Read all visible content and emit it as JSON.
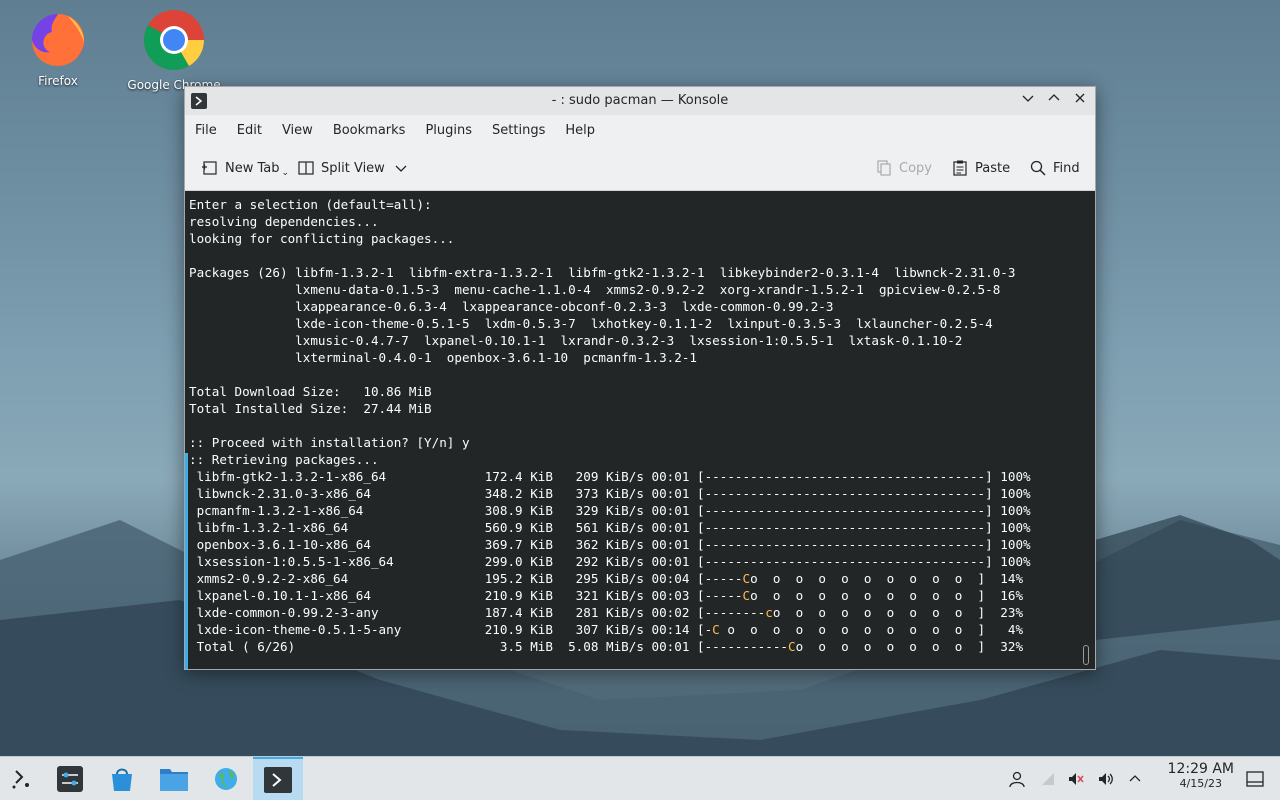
{
  "desktop": {
    "icons": [
      {
        "label": "Firefox",
        "icon": "firefox-icon"
      },
      {
        "label": "Google Chrome",
        "icon": "chrome-icon"
      }
    ]
  },
  "window": {
    "title": "- : sudo pacman — Konsole",
    "menu": [
      "File",
      "Edit",
      "View",
      "Bookmarks",
      "Plugins",
      "Settings",
      "Help"
    ],
    "toolbar": {
      "new_tab": "New Tab",
      "split_view": "Split View",
      "copy": "Copy",
      "paste": "Paste",
      "find": "Find"
    }
  },
  "terminal": {
    "lines": [
      "Enter a selection (default=all):",
      "resolving dependencies...",
      "looking for conflicting packages...",
      "",
      "Packages (26) libfm-1.3.2-1  libfm-extra-1.3.2-1  libfm-gtk2-1.3.2-1  libkeybinder2-0.3.1-4  libwnck-2.31.0-3",
      "              lxmenu-data-0.1.5-3  menu-cache-1.1.0-4  xmms2-0.9.2-2  xorg-xrandr-1.5.2-1  gpicview-0.2.5-8",
      "              lxappearance-0.6.3-4  lxappearance-obconf-0.2.3-3  lxde-common-0.99.2-3",
      "              lxde-icon-theme-0.5.1-5  lxdm-0.5.3-7  lxhotkey-0.1.1-2  lxinput-0.3.5-3  lxlauncher-0.2.5-4",
      "              lxmusic-0.4.7-7  lxpanel-0.10.1-1  lxrandr-0.3.2-3  lxsession-1:0.5.5-1  lxtask-0.1.10-2",
      "              lxterminal-0.4.0-1  openbox-3.6.1-10  pcmanfm-1.3.2-1",
      "",
      "Total Download Size:   10.86 MiB",
      "Total Installed Size:  27.44 MiB",
      "",
      ":: Proceed with installation? [Y/n] y",
      ":: Retrieving packages...",
      " libfm-gtk2-1.3.2-1-x86_64             172.4 KiB   209 KiB/s 00:01 [-------------------------------------] 100%",
      " libwnck-2.31.0-3-x86_64               348.2 KiB   373 KiB/s 00:01 [-------------------------------------] 100%",
      " pcmanfm-1.3.2-1-x86_64                308.9 KiB   329 KiB/s 00:01 [-------------------------------------] 100%",
      " libfm-1.3.2-1-x86_64                  560.9 KiB   561 KiB/s 00:01 [-------------------------------------] 100%",
      " openbox-3.6.1-10-x86_64               369.7 KiB   362 KiB/s 00:01 [-------------------------------------] 100%",
      " lxsession-1:0.5.5-1-x86_64            299.0 KiB   292 KiB/s 00:01 [-------------------------------------] 100%"
    ],
    "progress_lines": [
      {
        "pre": " xmms2-0.9.2-2-x86_64                  195.2 KiB   295 KiB/s 00:04 [-----",
        "mark": "C",
        "post": "o  o  o  o  o  o  o  o  o  o  ]  14%"
      },
      {
        "pre": " lxpanel-0.10.1-1-x86_64               210.9 KiB   321 KiB/s 00:03 [-----",
        "mark": "C",
        "post": "o  o  o  o  o  o  o  o  o  o  ]  16%"
      },
      {
        "pre": " lxde-common-0.99.2-3-any              187.4 KiB   281 KiB/s 00:02 [--------",
        "mark": "c",
        "post": "o  o  o  o  o  o  o  o  o  ]  23%"
      },
      {
        "pre": " lxde-icon-theme-0.5.1-5-any           210.9 KiB   307 KiB/s 00:14 [-",
        "mark": "C",
        "post": " o  o  o  o  o  o  o  o  o  o  o  ]   4%"
      },
      {
        "pre": " Total ( 6/26)                           3.5 MiB  5.08 MiB/s 00:01 [-----------",
        "mark": "C",
        "post": "o  o  o  o  o  o  o  o  ]  32%"
      }
    ]
  },
  "taskbar": {
    "time": "12:29 AM",
    "date": "4/15/23"
  }
}
